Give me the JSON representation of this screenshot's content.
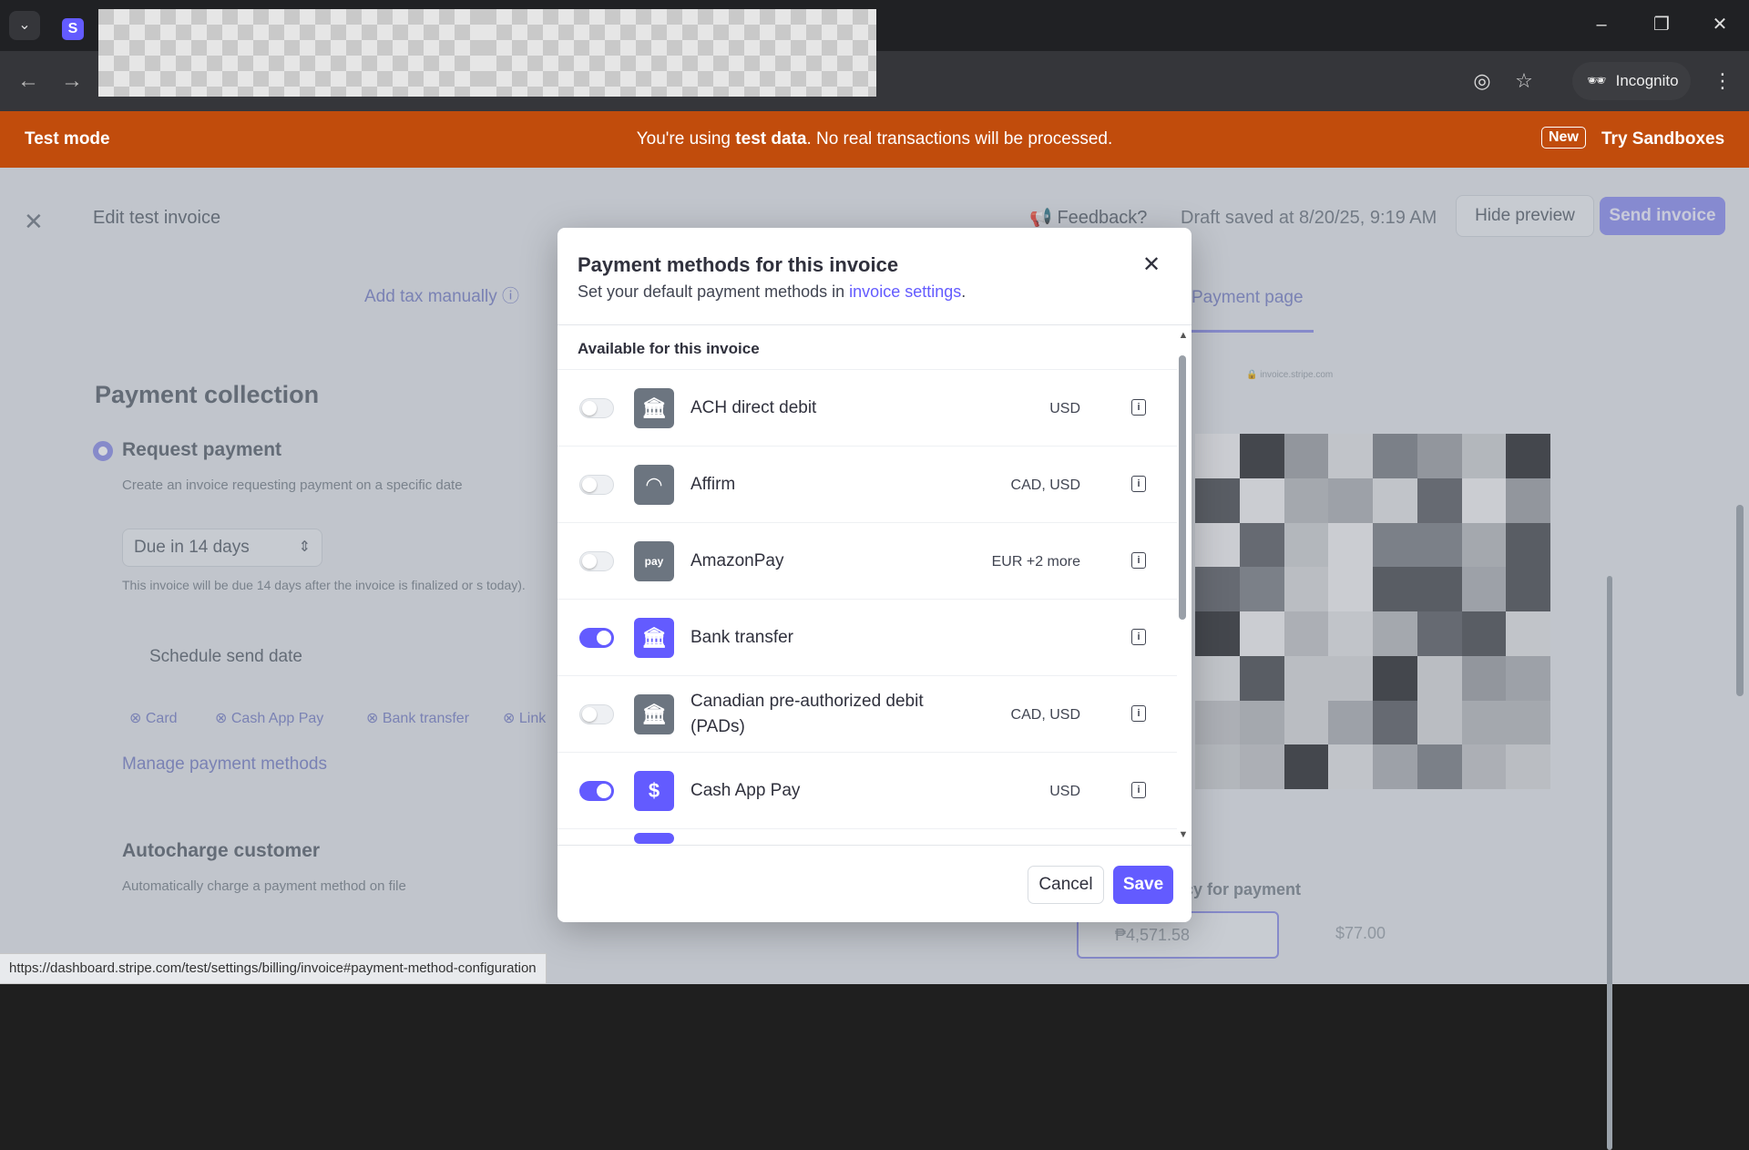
{
  "browser": {
    "incognito_label": "Incognito",
    "favicon_letter": "S"
  },
  "banner": {
    "left": "Test mode",
    "message_prefix": "You're using ",
    "message_bold": "test data",
    "message_suffix": ". No real transactions will be processed.",
    "new_badge": "New",
    "link": "Try Sandboxes"
  },
  "header": {
    "title": "Edit test invoice",
    "feedback": "Feedback?",
    "draft_status": "Draft saved at 8/20/25, 9:19 AM",
    "hide_preview": "Hide preview",
    "send_invoice": "Send invoice"
  },
  "editor": {
    "add_tax": "Add tax manually",
    "payment_collection": "Payment collection",
    "request_payment": "Request payment",
    "request_desc": "Create an invoice requesting payment on a specific date",
    "due_select": "Due in 14 days",
    "due_note": "This invoice will be due 14 days after the invoice is finalized or s today).",
    "schedule": "Schedule send date",
    "chips": [
      "Card",
      "Cash App Pay",
      "Bank transfer",
      "Link"
    ],
    "manage": "Manage payment methods",
    "autocharge_title": "Autocharge customer",
    "autocharge_desc": "Automatically charge a payment method on file"
  },
  "preview": {
    "tab": "Payment page",
    "url": "invoice.stripe.com",
    "currency_label": "cy for payment",
    "amount_primary": "₱4,571.58",
    "amount_alt": "$77.00"
  },
  "modal": {
    "title": "Payment methods for this invoice",
    "subtitle_prefix": "Set your default payment methods in ",
    "subtitle_link": "invoice settings",
    "subtitle_suffix": ".",
    "section": "Available for this invoice",
    "methods": [
      {
        "name": "ACH direct debit",
        "currency": "USD",
        "enabled": false,
        "icon": "bank-icon"
      },
      {
        "name": "Affirm",
        "currency": "CAD, USD",
        "enabled": false,
        "icon": "affirm-icon"
      },
      {
        "name": "AmazonPay",
        "currency": "EUR +2 more",
        "enabled": false,
        "icon": "amazon-pay-icon"
      },
      {
        "name": "Bank transfer",
        "currency": "",
        "enabled": true,
        "icon": "bank-icon"
      },
      {
        "name": "Canadian pre-authorized debit",
        "name2": "(PADs)",
        "currency": "CAD, USD",
        "enabled": false,
        "icon": "bank-icon"
      },
      {
        "name": "Cash App Pay",
        "currency": "USD",
        "enabled": true,
        "icon": "dollar-icon"
      }
    ],
    "cancel": "Cancel",
    "save": "Save"
  },
  "status_url": "https://dashboard.stripe.com/test/settings/billing/invoice#payment-method-configuration",
  "colors": {
    "accent": "#635bff",
    "banner": "#c14c0c"
  }
}
